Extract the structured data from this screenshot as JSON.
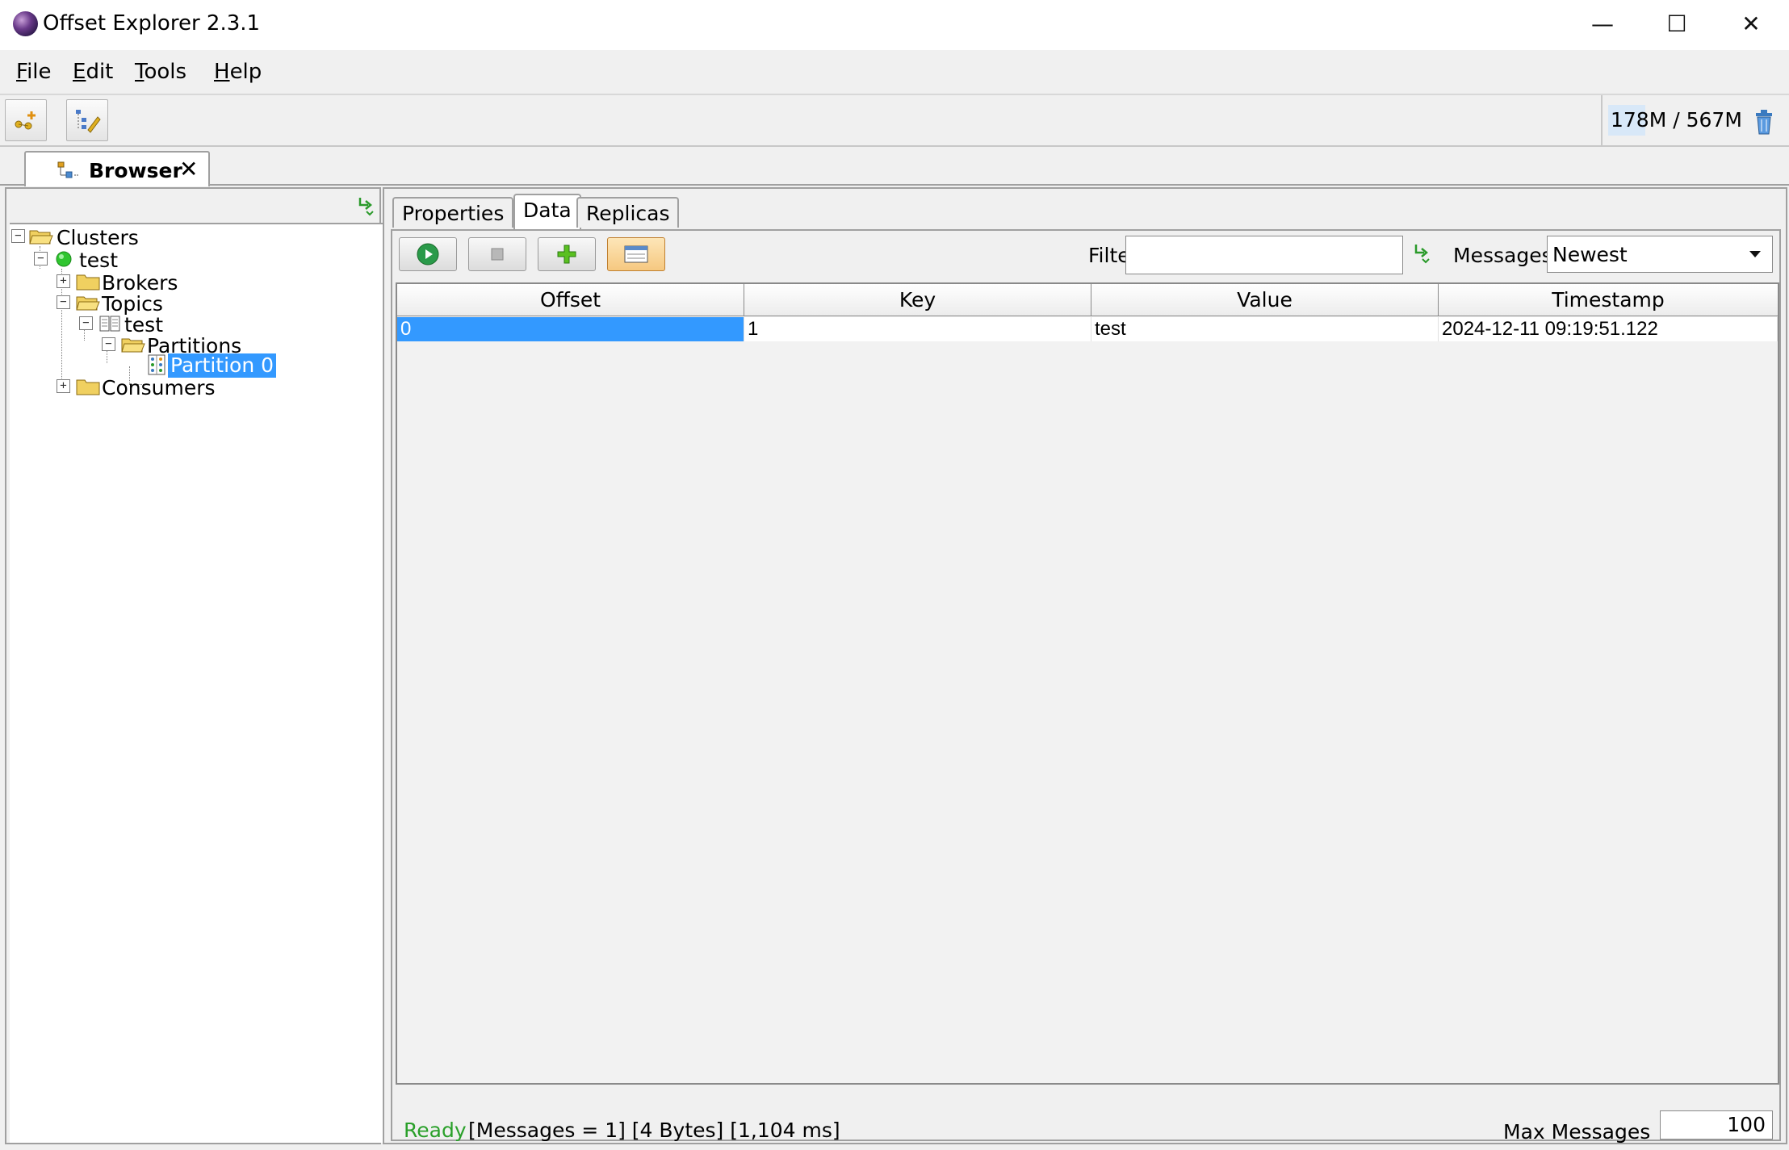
{
  "window": {
    "title": "Offset Explorer  2.3.1",
    "minimize_glyph": "—",
    "maximize_glyph": "☐",
    "close_glyph": "✕"
  },
  "menu": {
    "file_first": "F",
    "file_rest": "ile",
    "edit_first": "E",
    "edit_rest": "dit",
    "tools_first": "T",
    "tools_rest": "ools",
    "help_first": "H",
    "help_rest": "elp"
  },
  "toolbar": {
    "memory": "178M / 567M"
  },
  "browser_tab": {
    "label": "Browser",
    "close_glyph": "✕"
  },
  "tree": {
    "root": "Clusters",
    "cluster": "test",
    "brokers": "Brokers",
    "topics": "Topics",
    "topic": "test",
    "partitions": "Partitions",
    "partition": "Partition 0",
    "consumers": "Consumers",
    "cluster_status_color": "#2fc52f",
    "selection_color": "#3399ff"
  },
  "detail_tabs": {
    "properties": "Properties",
    "data": "Data",
    "replicas": "Replicas"
  },
  "data_panel": {
    "filter_label": "Filter",
    "filter_value": "",
    "messages_label": "Messages",
    "messages_value": "Newest",
    "columns": [
      "Offset",
      "Key",
      "Value",
      "Timestamp"
    ],
    "rows": [
      [
        "0",
        "1",
        "test",
        "2024-12-11 09:19:51.122"
      ]
    ],
    "status_ready": "Ready",
    "status_info": "[Messages = 1]  [4 Bytes]  [1,104 ms]",
    "max_messages_label": "Max Messages",
    "max_messages_value": "100"
  }
}
